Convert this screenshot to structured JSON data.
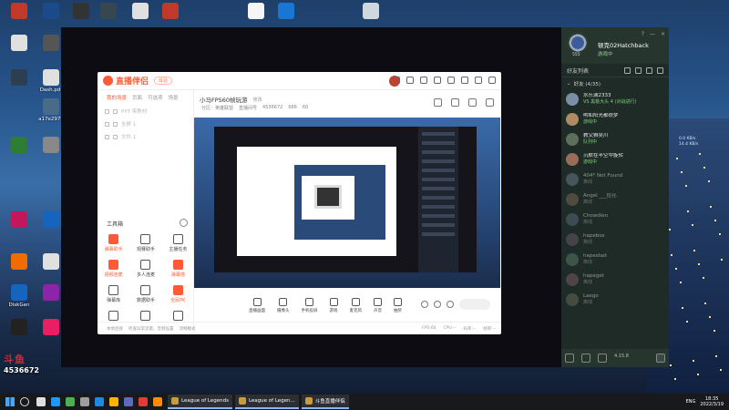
{
  "desktop": {
    "left_icons": [
      {
        "label": "",
        "color": "#c0392b"
      },
      {
        "label": "",
        "color": "#1a4a8a"
      },
      {
        "label": "",
        "color": "#333333"
      },
      {
        "label": "",
        "color": "#e0e0e0"
      },
      {
        "label": "",
        "color": "#555555"
      },
      {
        "label": "",
        "color": "#2c3e50"
      },
      {
        "label": "Dash.pdf",
        "color": "#e0e0e0"
      },
      {
        "label": "a17e297b",
        "color": "#4a6a8a"
      },
      {
        "label": "",
        "color": "#2e7d32"
      },
      {
        "label": "",
        "color": "#888888"
      },
      {
        "label": "",
        "color": "#c2185b"
      },
      {
        "label": "",
        "color": "#1565c0"
      },
      {
        "label": "",
        "color": "#ef6c00"
      },
      {
        "label": "",
        "color": "#e0e0e0"
      },
      {
        "label": "DiskGen",
        "color": "#1565c0"
      },
      {
        "label": "",
        "color": "#8e24aa"
      },
      {
        "label": "",
        "color": "#222222"
      },
      {
        "label": "",
        "color": "#e91e63"
      }
    ],
    "top_icons": [
      {
        "color": "#37474f"
      },
      {
        "color": "#e0e0e0"
      },
      {
        "color": "#c0392b"
      },
      {
        "color": "#f5f5f5"
      },
      {
        "color": "#1976d2"
      },
      {
        "color": "#cfd8dc"
      }
    ]
  },
  "app": {
    "logo": "直播伴侣",
    "version": "体验",
    "scene_tabs": [
      "我的场景",
      "页面",
      "可选项",
      "场景"
    ],
    "layers": [
      {
        "label": "PPT 带教材"
      },
      {
        "label": "全屏 1"
      },
      {
        "label": "文件 1"
      }
    ],
    "tools_title": "工具箱",
    "tools": [
      {
        "label": "弹幕助手",
        "hot": true
      },
      {
        "label": "观赛助手",
        "hot": false
      },
      {
        "label": "主播任务",
        "hot": false
      },
      {
        "label": "视频连麦",
        "hot": true
      },
      {
        "label": "多人连麦",
        "hot": false
      },
      {
        "label": "弹幕墙",
        "hot": true
      },
      {
        "label": "弹幕库",
        "hot": false
      },
      {
        "label": "数据助手",
        "hot": false
      },
      {
        "label": "全民PK",
        "hot": true
      },
      {
        "label": "",
        "hot": false
      },
      {
        "label": "",
        "hot": false
      },
      {
        "label": "",
        "hot": false
      }
    ],
    "room_title": "小马FPS60帧玩游",
    "room_edit": "修改",
    "room_meta": [
      "分区：英雄联盟",
      "直播间号",
      "4536672",
      "688",
      "60"
    ],
    "controls": [
      "直播画面",
      "摄像头",
      "手机投屏",
      "游戏",
      "麦克风",
      "声音",
      "抽奖"
    ],
    "start_label": "",
    "status": {
      "left": [
        "本地连接",
        "检查异常流量，音频设置",
        "流畅模式"
      ],
      "right": [
        "FPS:60",
        "CPU:--",
        "码率:--",
        "帧率:--"
      ]
    }
  },
  "friends": {
    "name": "顿克02Hatchback",
    "status": "游戏中",
    "level": "555",
    "list_title": "好友列表",
    "group_label": "好友 (4/35)",
    "items": [
      {
        "name": "水乐满2333",
        "status": "VS 黑桃大头 4 (对战进行)",
        "online": true,
        "color": "#7a8fa6"
      },
      {
        "name": "哟和阳光都很梦",
        "status": "游戏中",
        "online": true,
        "color": "#b08a62"
      },
      {
        "name": "教父狮吴川",
        "status": "队列中",
        "online": true,
        "color": "#5c6f5a"
      },
      {
        "name": "沉默在半空中旋转",
        "status": "游戏中",
        "online": true,
        "color": "#9a6c5a"
      },
      {
        "name": "404* Not Found",
        "status": "离线",
        "online": false,
        "color": "#667788"
      },
      {
        "name": "Angel ___拉花",
        "status": "离线",
        "online": false,
        "color": "#776655"
      },
      {
        "name": "Chowdien",
        "status": "离线",
        "online": false,
        "color": "#556677"
      },
      {
        "name": "hapebox",
        "status": "离线",
        "online": false,
        "color": "#665566"
      },
      {
        "name": "hapestad",
        "status": "离线",
        "online": false,
        "color": "#557766"
      },
      {
        "name": "hapeget",
        "status": "离线",
        "online": false,
        "color": "#775566"
      },
      {
        "name": "Laego",
        "status": "离线",
        "online": false,
        "color": "#666655"
      }
    ],
    "bottom_code": "4.15.8"
  },
  "net": {
    "up": "0.0 KB/s",
    "down": "14.4 KB/s"
  },
  "watermark": {
    "logo": "斗鱼",
    "room": "4536672"
  },
  "taskbar": {
    "apps": [
      {
        "color": "#e0e0e0"
      },
      {
        "color": "#2196f3"
      },
      {
        "color": "#4caf50"
      },
      {
        "color": "#9e9e9e"
      },
      {
        "color": "#1e88e5"
      },
      {
        "color": "#ffb300"
      },
      {
        "color": "#5c6bc0"
      },
      {
        "color": "#e53935"
      },
      {
        "color": "#fb8c00"
      }
    ],
    "tasks": [
      "League of Legends",
      "League of Legen...",
      "斗鱼直播伴侣"
    ],
    "lang": "ENG",
    "time": "18:35",
    "date": "2022/3/19"
  }
}
